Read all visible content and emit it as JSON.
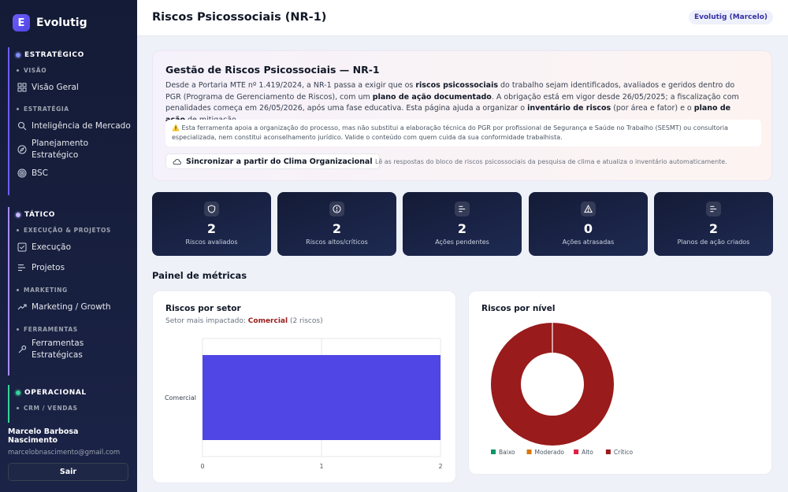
{
  "app": {
    "name": "Evolutig",
    "logo_letter": "E"
  },
  "sidebar": {
    "groups": [
      {
        "title": "ESTRATÉGICO",
        "sections": [
          {
            "title": "VISÃO",
            "items": [
              "Visão Geral"
            ]
          },
          {
            "title": "ESTRATÉGIA",
            "items": [
              "Inteligência de Mercado",
              "Planejamento Estratégico",
              "BSC"
            ]
          }
        ]
      },
      {
        "title": "TÁTICO",
        "sections": [
          {
            "title": "EXECUÇÃO & PROJETOS",
            "items": [
              "Execução",
              "Projetos"
            ]
          },
          {
            "title": "MARKETING",
            "items": [
              "Marketing / Growth"
            ]
          },
          {
            "title": "FERRAMENTAS",
            "items": [
              "Ferramentas Estratégicas"
            ]
          }
        ]
      },
      {
        "title": "OPERACIONAL",
        "sections": [
          {
            "title": "CRM / VENDAS",
            "items": []
          }
        ]
      }
    ],
    "user": {
      "name": "Marcelo Barbosa Nascimento",
      "email": "marcelobnascimento@gmail.com",
      "logout": "Sair"
    }
  },
  "header": {
    "title": "Riscos Psicossociais (NR-1)",
    "org": "Evolutig (Marcelo)"
  },
  "intro": {
    "title": "Gestão de Riscos Psicossociais — NR-1",
    "p1": "Desde a Portaria MTE nº 1.419/2024, a NR-1 passa a exigir que os ",
    "b1": "riscos psicossociais",
    "p2": " do trabalho sejam identificados, avaliados e geridos dentro do PGR (Programa de Gerenciamento de Riscos), com um ",
    "b2": "plano de ação documentado",
    "p3": ". A obrigação está em vigor desde 26/05/2025; a fiscalização com penalidades começa em 26/05/2026, após uma fase educativa. Esta página ajuda a organizar o ",
    "b3": "inventário de riscos",
    "p4": " (por área e fator) e o ",
    "b4": "plano de ação",
    "p5": " de mitigação.",
    "warning": "⚠️ Esta ferramenta apoia a organização do processo, mas não substitui a elaboração técnica do PGR por profissional de Segurança e Saúde no Trabalho (SESMT) ou consultoria especializada, nem constitui aconselhamento jurídico. Valide o conteúdo com quem cuida da sua conformidade trabalhista.",
    "sync_button": "Sincronizar a partir do Clima Organizacional",
    "sync_note": "Lê as respostas do bloco de riscos psicossociais da pesquisa de clima e atualiza o inventário automaticamente."
  },
  "kpis": [
    {
      "value": "2",
      "label": "Riscos avaliados",
      "icon": "shield-icon"
    },
    {
      "value": "2",
      "label": "Riscos altos/críticos",
      "icon": "alert-circle-icon"
    },
    {
      "value": "2",
      "label": "Ações pendentes",
      "icon": "list-icon"
    },
    {
      "value": "0",
      "label": "Ações atrasadas",
      "icon": "warning-triangle-icon"
    },
    {
      "value": "2",
      "label": "Planos de ação criados",
      "icon": "list-icon"
    }
  ],
  "metrics_title": "Painel de métricas",
  "charts": {
    "sector_title": "Riscos por setor",
    "sector_sub_prefix": "Setor mais impactado: ",
    "sector_sub_highlight": "Comercial",
    "sector_sub_suffix": " (2 riscos)",
    "level_title": "Riscos por nível"
  },
  "chart_data": [
    {
      "type": "bar",
      "orientation": "horizontal",
      "title": "Riscos por setor",
      "categories": [
        "Comercial"
      ],
      "values": [
        2
      ],
      "xlim": [
        0,
        2
      ],
      "xticks": [
        0,
        1,
        2
      ],
      "grid": true,
      "color": "#4f46e5"
    },
    {
      "type": "pie",
      "subtype": "donut",
      "title": "Riscos por nível",
      "categories": [
        "Baixo",
        "Moderado",
        "Alto",
        "Crítico"
      ],
      "values": [
        0,
        0,
        0,
        2
      ],
      "colors": [
        "#059669",
        "#d97706",
        "#e11d48",
        "#991b1b"
      ],
      "legend": "bottom"
    }
  ]
}
